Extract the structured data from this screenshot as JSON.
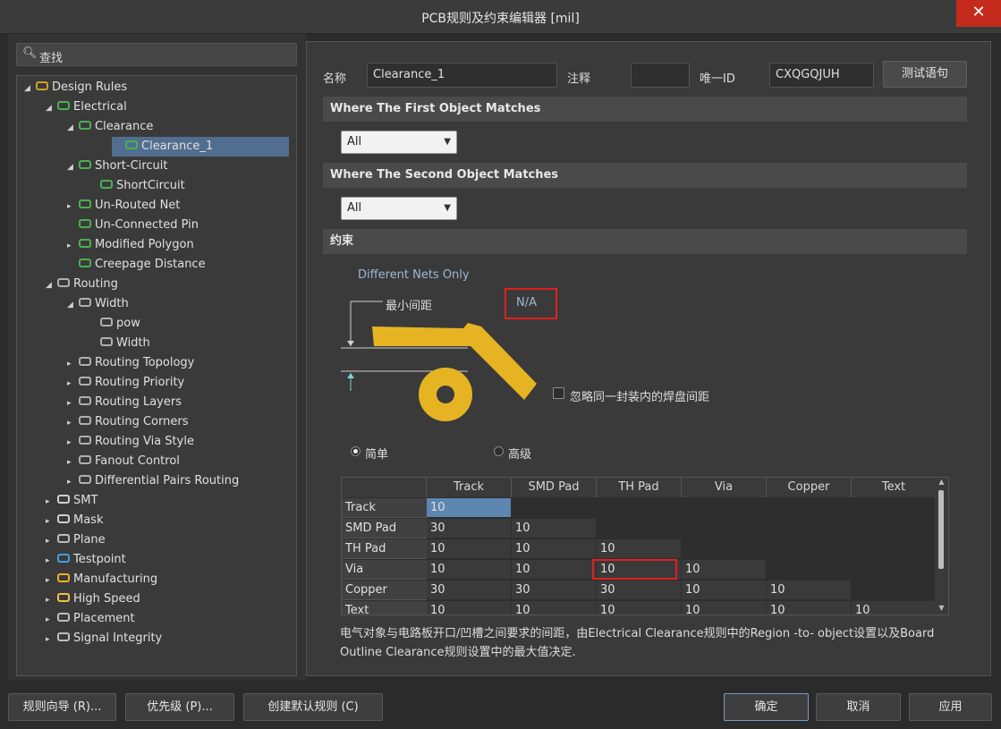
{
  "window": {
    "title": "PCB规则及约束编辑器 [mil]",
    "close": "✕"
  },
  "search": {
    "placeholder": "查找"
  },
  "tree": [
    {
      "label": "Design Rules",
      "arrow": "◢",
      "indent": 0,
      "icon": "rules-icon"
    },
    {
      "label": "Electrical",
      "arrow": "◢",
      "indent": 1,
      "icon": "electrical-icon"
    },
    {
      "label": "Clearance",
      "arrow": "◢",
      "indent": 2,
      "icon": "electrical-icon"
    },
    {
      "label": "Clearance_1",
      "arrow": "",
      "indent": 3,
      "icon": "electrical-icon",
      "selected": true
    },
    {
      "label": "Short-Circuit",
      "arrow": "◢",
      "indent": 2,
      "icon": "electrical-icon"
    },
    {
      "label": "ShortCircuit",
      "arrow": "",
      "indent": 3,
      "icon": "electrical-icon"
    },
    {
      "label": "Un-Routed Net",
      "arrow": "▸",
      "indent": 2,
      "icon": "electrical-icon"
    },
    {
      "label": "Un-Connected Pin",
      "arrow": "",
      "indent": 2,
      "icon": "electrical-icon"
    },
    {
      "label": "Modified Polygon",
      "arrow": "▸",
      "indent": 2,
      "icon": "electrical-icon"
    },
    {
      "label": "Creepage Distance",
      "arrow": "",
      "indent": 2,
      "icon": "electrical-icon"
    },
    {
      "label": "Routing",
      "arrow": "◢",
      "indent": 1,
      "icon": "routing-icon"
    },
    {
      "label": "Width",
      "arrow": "◢",
      "indent": 2,
      "icon": "routing-icon"
    },
    {
      "label": "pow",
      "arrow": "",
      "indent": 3,
      "icon": "routing-icon"
    },
    {
      "label": "Width",
      "arrow": "",
      "indent": 3,
      "icon": "routing-icon"
    },
    {
      "label": "Routing Topology",
      "arrow": "▸",
      "indent": 2,
      "icon": "routing-icon"
    },
    {
      "label": "Routing Priority",
      "arrow": "▸",
      "indent": 2,
      "icon": "routing-icon"
    },
    {
      "label": "Routing Layers",
      "arrow": "▸",
      "indent": 2,
      "icon": "routing-icon"
    },
    {
      "label": "Routing Corners",
      "arrow": "▸",
      "indent": 2,
      "icon": "routing-icon"
    },
    {
      "label": "Routing Via Style",
      "arrow": "▸",
      "indent": 2,
      "icon": "routing-icon"
    },
    {
      "label": "Fanout Control",
      "arrow": "▸",
      "indent": 2,
      "icon": "routing-icon"
    },
    {
      "label": "Differential Pairs Routing",
      "arrow": "▸",
      "indent": 2,
      "icon": "routing-icon"
    },
    {
      "label": "SMT",
      "arrow": "▸",
      "indent": 1,
      "icon": "smt-icon"
    },
    {
      "label": "Mask",
      "arrow": "▸",
      "indent": 1,
      "icon": "mask-icon"
    },
    {
      "label": "Plane",
      "arrow": "▸",
      "indent": 1,
      "icon": "plane-icon"
    },
    {
      "label": "Testpoint",
      "arrow": "▸",
      "indent": 1,
      "icon": "testpoint-icon"
    },
    {
      "label": "Manufacturing",
      "arrow": "▸",
      "indent": 1,
      "icon": "manufacturing-icon"
    },
    {
      "label": "High Speed",
      "arrow": "▸",
      "indent": 1,
      "icon": "highspeed-icon"
    },
    {
      "label": "Placement",
      "arrow": "▸",
      "indent": 1,
      "icon": "placement-icon"
    },
    {
      "label": "Signal Integrity",
      "arrow": "▸",
      "indent": 1,
      "icon": "signal-icon"
    }
  ],
  "form": {
    "name_label": "名称",
    "name_value": "Clearance_1",
    "comment_label": "注释",
    "comment_value": "",
    "uid_label": "唯一ID",
    "uid_value": "CXQGQJUH",
    "test_button": "测试语句"
  },
  "first_match": {
    "header": "Where The First Object Matches",
    "value": "All"
  },
  "second_match": {
    "header": "Where The Second Object Matches",
    "value": "All"
  },
  "constraints": {
    "header": "约束",
    "different_nets": "Different Nets Only",
    "min_clearance_label": "最小间距",
    "min_clearance_value": "N/A",
    "ignore_pad_label": "忽略同一封装内的焊盘间距",
    "ignore_pad_checked": false,
    "mode_simple": "简单",
    "mode_advanced": "高级",
    "mode_selected": "simple"
  },
  "matrix": {
    "columns": [
      "Track",
      "SMD Pad",
      "TH Pad",
      "Via",
      "Copper",
      "Text"
    ],
    "rows": [
      {
        "name": "Track",
        "values": [
          "10",
          "",
          "",
          "",
          "",
          ""
        ]
      },
      {
        "name": "SMD Pad",
        "values": [
          "30",
          "10",
          "",
          "",
          "",
          ""
        ]
      },
      {
        "name": "TH Pad",
        "values": [
          "10",
          "10",
          "10",
          "",
          "",
          ""
        ]
      },
      {
        "name": "Via",
        "values": [
          "10",
          "10",
          "10",
          "10",
          "",
          ""
        ]
      },
      {
        "name": "Copper",
        "values": [
          "30",
          "30",
          "30",
          "10",
          "10",
          ""
        ]
      },
      {
        "name": "Text",
        "values": [
          "10",
          "10",
          "10",
          "10",
          "10",
          "10"
        ]
      }
    ]
  },
  "note": "电气对象与电路板开口/凹槽之间要求的间距，由Electrical Clearance规则中的Region -to- object设置以及Board Outline Clearance规则设置中的最大值决定.",
  "bottom": {
    "wizard": "规则向导 (R)...",
    "priority": "优先级 (P)...",
    "create_default": "创建默认规则 (C)",
    "ok": "确定",
    "cancel": "取消",
    "apply": "应用"
  },
  "colors": {
    "accent": "#516e8f",
    "highlight_red": "#e02020",
    "copper": "#e6b422"
  }
}
